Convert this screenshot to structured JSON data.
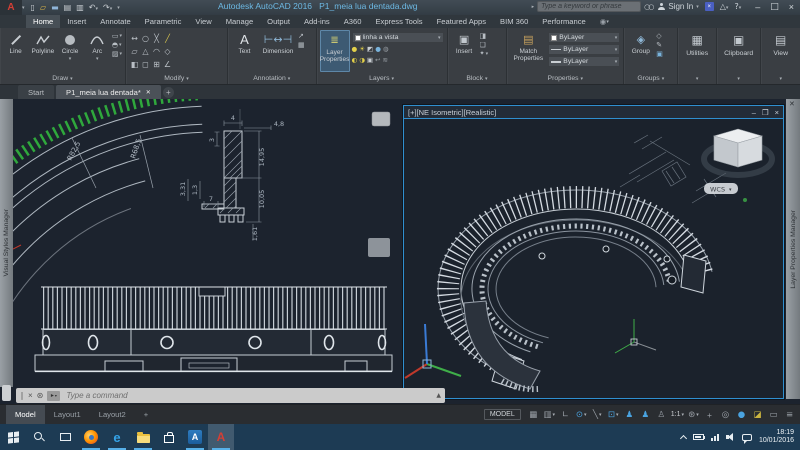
{
  "colors": {
    "accent_blue": "#4aa3e0",
    "autocad_red": "#d43f35",
    "hatch_green": "#2fa83c",
    "canvas": "#1c232e",
    "viewport_border": "#2f8fd0",
    "taskbar": "#1d3b54",
    "title_text": "#6db9e4"
  },
  "titlebar": {
    "app_title": "Autodesk AutoCAD 2016",
    "doc_title": "P1_meia lua dentada.dwg",
    "search_placeholder": "Type a keyword or phrase",
    "sign_in_label": "Sign In"
  },
  "ribbon": {
    "tabs": [
      "Home",
      "Insert",
      "Annotate",
      "Parametric",
      "View",
      "Manage",
      "Output",
      "Add-ins",
      "A360",
      "Express Tools",
      "Featured Apps",
      "BIM 360",
      "Performance"
    ],
    "panels": {
      "draw": {
        "label": "Draw",
        "tools": [
          "Line",
          "Polyline",
          "Circle",
          "Arc"
        ]
      },
      "modify": {
        "label": "Modify"
      },
      "annotation": {
        "label": "Annotation",
        "tools": [
          "Text",
          "Dimension"
        ]
      },
      "layers": {
        "label": "Layers",
        "tool": "Layer Properties",
        "current_layer": "linha a vista"
      },
      "block": {
        "label": "Block",
        "tool": "Insert"
      },
      "properties": {
        "label": "Properties",
        "tool": "Match Properties",
        "color": "ByLayer",
        "linetype": "ByLayer",
        "lineweight": "ByLayer"
      },
      "groups": {
        "label": "Groups",
        "tool": "Group"
      },
      "utilities": {
        "label": "Utilities"
      },
      "clipboard": {
        "label": "Clipboard"
      },
      "view": {
        "label": "View"
      }
    }
  },
  "file_tabs": {
    "start": "Start",
    "active": "P1_meia lua dentada*"
  },
  "palettes": {
    "left": "Visual Styles Manager",
    "right": "Layer Properties Manager"
  },
  "viewport": {
    "label": "[+][NE Isometric][Realistic]",
    "viewcube": "WCS"
  },
  "drawing": {
    "radii": [
      "R82,5",
      "R68,5"
    ],
    "dims": {
      "d4": "4",
      "d48": "4,8",
      "d3": "3",
      "d1495": "14,95",
      "d7": "7",
      "d13": "1,3",
      "d331": "3,31",
      "d1005": "10,05",
      "d161": "1,61"
    }
  },
  "command": {
    "prompt": "Type a command"
  },
  "layout_tabs": {
    "model": "Model",
    "layout1": "Layout1",
    "layout2": "Layout2"
  },
  "status": {
    "model": "MODEL",
    "scale": "1:1"
  },
  "taskbar": {
    "time": "18:19",
    "date": "10/01/2016"
  }
}
